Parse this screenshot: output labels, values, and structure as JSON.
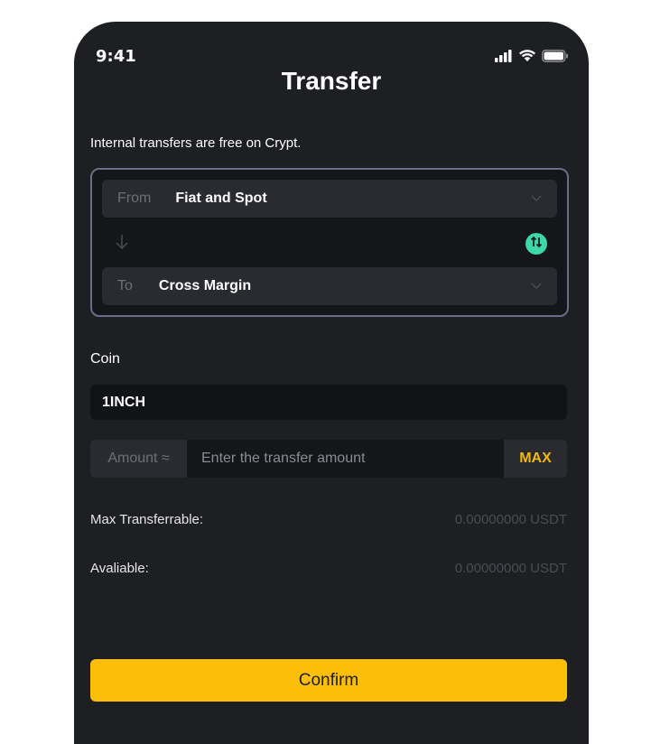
{
  "status_bar": {
    "time": "9:41",
    "icons": [
      "signal-icon",
      "wifi-icon",
      "battery-icon"
    ]
  },
  "header": {
    "title": "Transfer"
  },
  "info_text": "Internal transfers are free on Crypt.",
  "transfer": {
    "from_label": "From",
    "from_value": "Fiat and Spot",
    "to_label": "To",
    "to_value": "Cross Margin",
    "swap_color": "#3ed7a6"
  },
  "coin": {
    "label": "Coin",
    "value": "1INCH"
  },
  "amount": {
    "label": "Amount ≈",
    "placeholder": "Enter the transfer amount",
    "max_label": "MAX"
  },
  "details": {
    "max_transferrable_label": "Max Transferrable:",
    "max_transferrable_value": "0.00000000 USDT",
    "available_label": "Avaliable:",
    "available_value": "0.00000000 USDT"
  },
  "confirm_label": "Confirm",
  "colors": {
    "accent": "#fcbf09",
    "background": "#1e1f23",
    "max_text": "#f0b90b"
  }
}
